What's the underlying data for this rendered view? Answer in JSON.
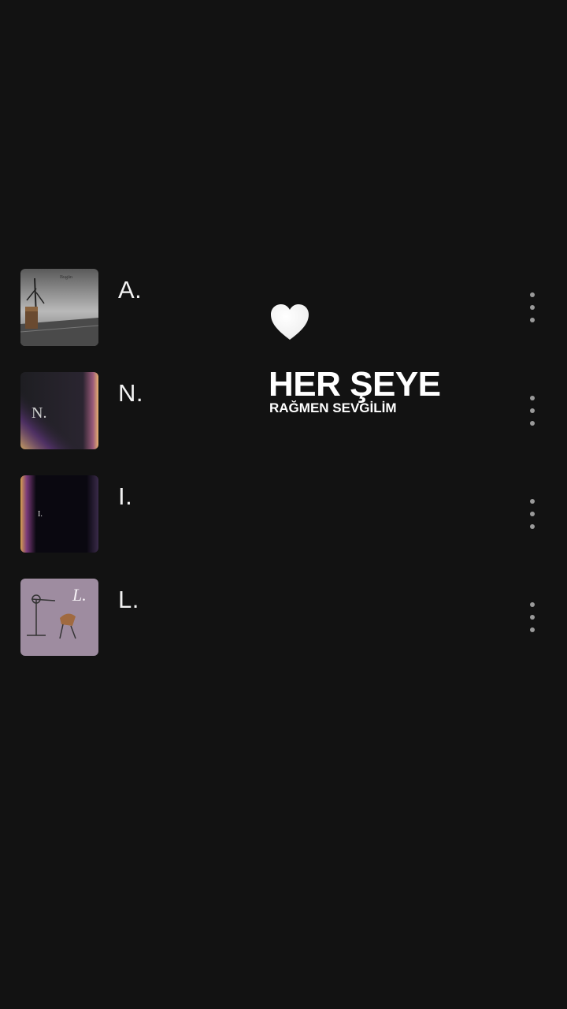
{
  "tracks": [
    {
      "title": "A.",
      "cover_name": "cover-a",
      "cover_text": "Bugün"
    },
    {
      "title": "N.",
      "cover_name": "cover-n",
      "cover_text": "N."
    },
    {
      "title": "I.",
      "cover_name": "cover-i",
      "cover_text": "I."
    },
    {
      "title": "L.",
      "cover_name": "cover-l",
      "cover_text": "L."
    }
  ],
  "overlay": {
    "heart_icon": "white-heart-icon",
    "title": "HER ŞEYE",
    "subtitle": "RAĞMEN SEVGİLİM"
  },
  "colors": {
    "background": "#121212",
    "title_text": "#f2f2f2",
    "menu_dots": "#9a9a9a",
    "overlay_text": "#ffffff"
  }
}
